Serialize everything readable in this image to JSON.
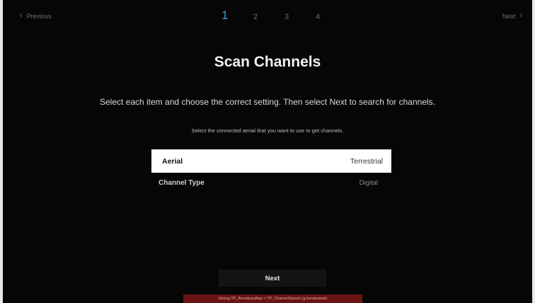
{
  "nav": {
    "previous_label": "Previous",
    "next_label": "Next",
    "steps": [
      "1",
      "2",
      "3",
      "4"
    ],
    "active_step": 1,
    "accent_color": "#2e9fd9"
  },
  "page": {
    "title": "Scan Channels",
    "subtitle": "Select each item and choose the correct setting. Then select Next to search for channels.",
    "hint": "Select the connected aerial that you want to use to get channels."
  },
  "settings": [
    {
      "label": "Aerial",
      "value": "Terrestrial",
      "focused": true
    },
    {
      "label": "Channel Type",
      "value": "Digital",
      "focused": false
    }
  ],
  "actions": {
    "next_button_label": "Next"
  },
  "debug": {
    "text": "Debug:TP_BroadcastApp > TP_ChannelSearch (g.burakowski)",
    "bar_color": "#6b1212"
  },
  "icons": {
    "previous": "chevron-left-icon",
    "next": "chevron-right-icon"
  }
}
